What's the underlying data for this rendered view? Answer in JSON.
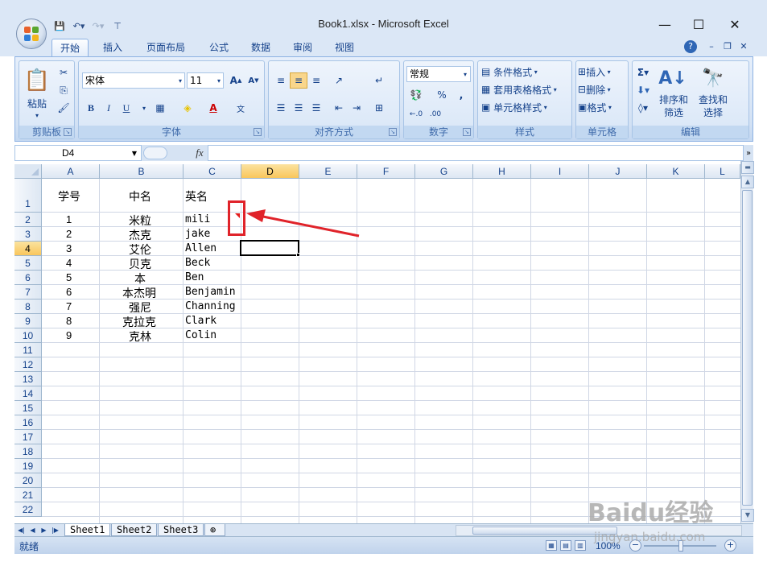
{
  "window": {
    "title": "Book1.xlsx - Microsoft Excel",
    "minimize_glyph": "—",
    "maximize_glyph": "☐",
    "close_glyph": "✕"
  },
  "ribbon": {
    "tabs": [
      "开始",
      "插入",
      "页面布局",
      "公式",
      "数据",
      "审阅",
      "视图"
    ],
    "clipboard": {
      "paste": "粘贴",
      "label": "剪贴板"
    },
    "font": {
      "name": "宋体",
      "size": "11",
      "bold": "B",
      "italic": "I",
      "underline": "U",
      "label": "字体"
    },
    "alignment": {
      "label": "对齐方式"
    },
    "number": {
      "format": "常规",
      "percent": "%",
      "comma": ",",
      "label": "数字"
    },
    "styles": {
      "conditional": "条件格式",
      "table": "套用表格格式",
      "cell_styles": "单元格样式",
      "label": "样式"
    },
    "cells": {
      "insert": "插入",
      "delete": "删除",
      "format": "格式",
      "label": "单元格"
    },
    "editing": {
      "sort": "排序和",
      "sort2": "筛选",
      "find": "查找和",
      "find2": "选择",
      "label": "编辑"
    }
  },
  "formula_bar": {
    "name_box": "D4",
    "fx": "fx",
    "value": ""
  },
  "columns": [
    "A",
    "B",
    "C",
    "D",
    "E",
    "F",
    "G",
    "H",
    "I",
    "J",
    "K",
    "L"
  ],
  "selected_column": "D",
  "selected_row": "4",
  "rows": [
    "1",
    "2",
    "3",
    "4",
    "5",
    "6",
    "7",
    "8",
    "9",
    "10",
    "11",
    "12",
    "13",
    "14",
    "15",
    "16",
    "17",
    "18",
    "19",
    "20",
    "21",
    "22"
  ],
  "table": [
    {
      "a": "学号",
      "b": "中名",
      "c": "英名"
    },
    {
      "a": "1",
      "b": "米粒",
      "c": "mili"
    },
    {
      "a": "2",
      "b": "杰克",
      "c": "jake"
    },
    {
      "a": "3",
      "b": "艾伦",
      "c": "Allen"
    },
    {
      "a": "4",
      "b": "贝克",
      "c": "Beck"
    },
    {
      "a": "5",
      "b": "本",
      "c": "Ben"
    },
    {
      "a": "6",
      "b": "本杰明",
      "c": "Benjamin"
    },
    {
      "a": "7",
      "b": "强尼",
      "c": "Channing"
    },
    {
      "a": "8",
      "b": "克拉克",
      "c": "Clark"
    },
    {
      "a": "9",
      "b": "克林",
      "c": "Colin"
    }
  ],
  "sheets": [
    "Sheet1",
    "Sheet2",
    "Sheet3"
  ],
  "status": {
    "ready": "就绪",
    "zoom": "100%"
  },
  "watermark": {
    "brand": "Baidu经验",
    "url": "jingyan.baidu.com"
  },
  "colors": {
    "annotation": "#e0232a",
    "ribbon": "#dbe7f6",
    "selected_header": "#f9c65c"
  }
}
